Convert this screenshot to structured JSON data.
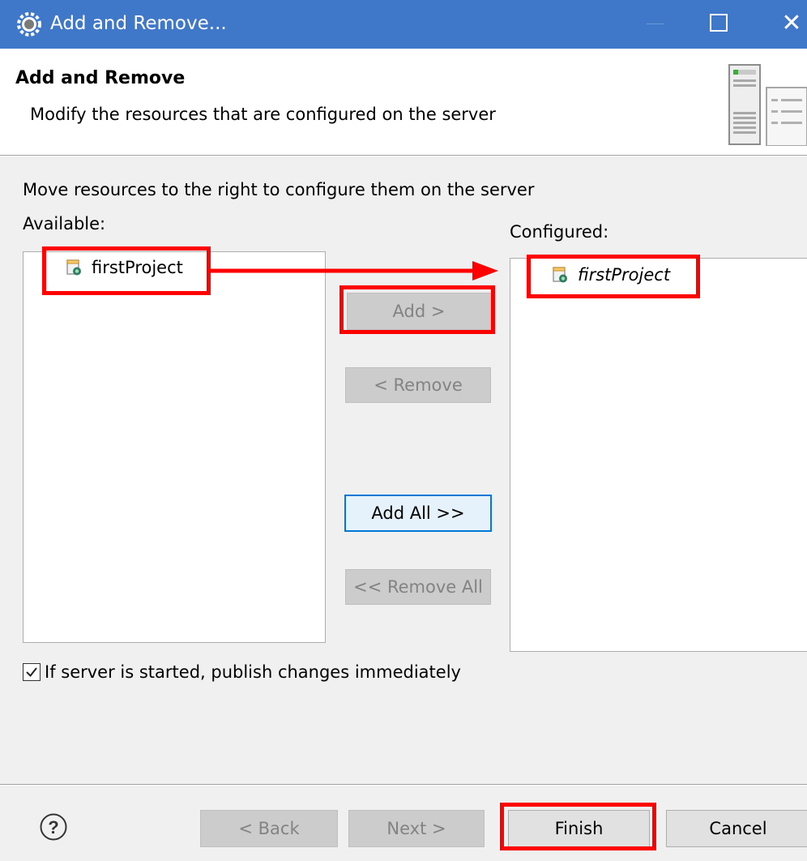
{
  "window": {
    "title": "Add and Remove...",
    "titlebar_color": "#3f77c9"
  },
  "header": {
    "title": "Add and Remove",
    "description": "Modify the resources that are configured on the server",
    "image": "server-icon"
  },
  "instruction": "Move resources to the right to configure them on the server",
  "available": {
    "label": "Available:",
    "items": [
      {
        "label": "firstProject",
        "icon": "project-icon"
      }
    ]
  },
  "configured": {
    "label": "Configured:",
    "items": [
      {
        "label": "firstProject",
        "icon": "project-icon",
        "italic": true
      }
    ]
  },
  "buttons": {
    "add": {
      "label": "Add >",
      "enabled": false
    },
    "remove": {
      "label": "< Remove",
      "enabled": false
    },
    "add_all": {
      "label": "Add All >>",
      "enabled": true,
      "default": true
    },
    "remove_all": {
      "label": "<< Remove All",
      "enabled": false
    }
  },
  "publish_option": {
    "label": "If server is started, publish changes immediately",
    "checked": true
  },
  "footer": {
    "help_icon": "help-icon",
    "back": {
      "label": "< Back",
      "enabled": false
    },
    "next": {
      "label": "Next >",
      "enabled": false
    },
    "finish": {
      "label": "Finish",
      "enabled": true
    },
    "cancel": {
      "label": "Cancel",
      "enabled": true
    }
  },
  "annotation_color": "#ff0000"
}
